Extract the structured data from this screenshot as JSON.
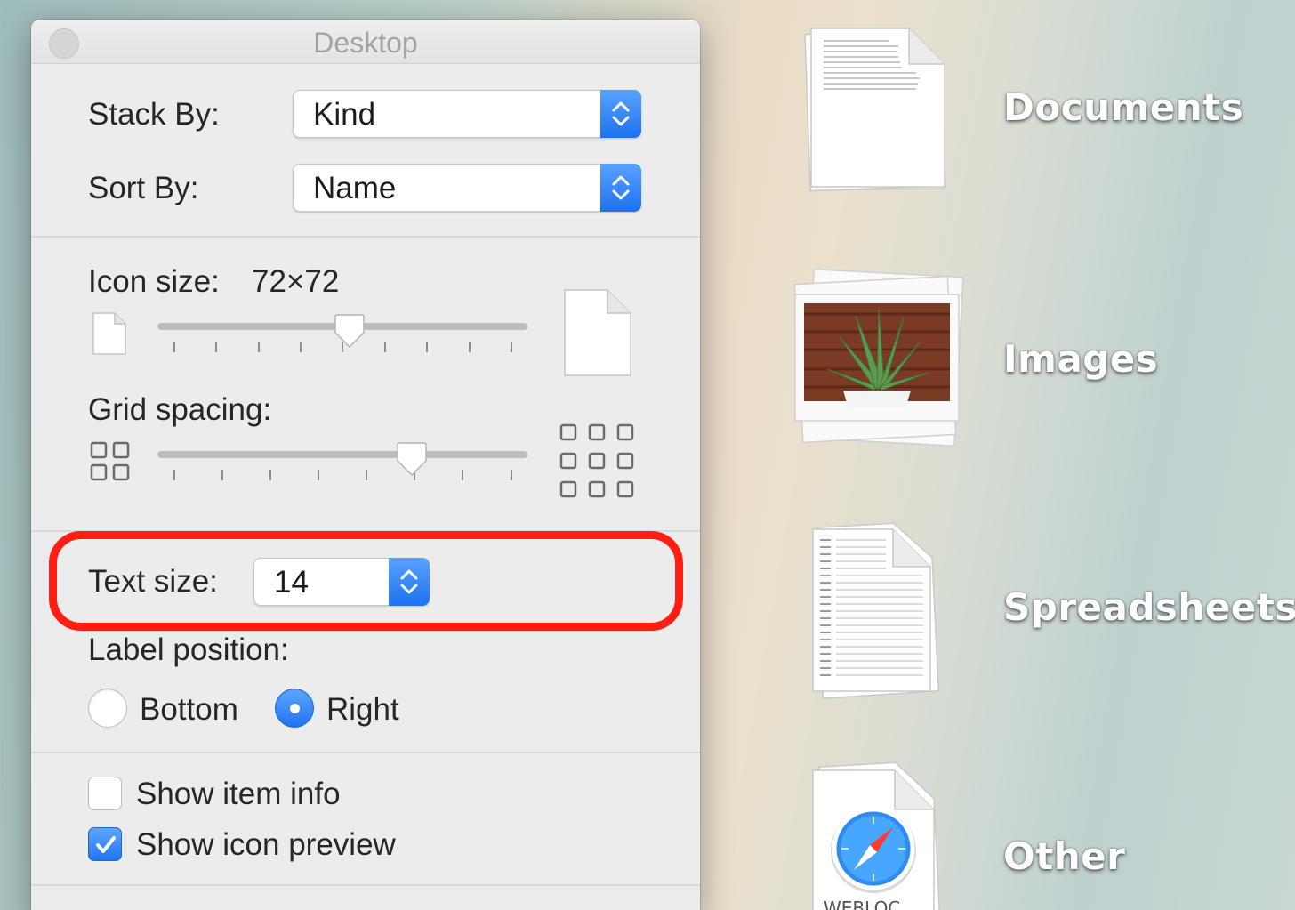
{
  "window": {
    "title": "Desktop"
  },
  "stack_by": {
    "label": "Stack By:",
    "value": "Kind"
  },
  "sort_by": {
    "label": "Sort By:",
    "value": "Name"
  },
  "icon_size": {
    "label": "Icon size:",
    "value": "72×72",
    "slider_level": 0.5
  },
  "grid_spacing": {
    "label": "Grid spacing:",
    "slider_level": 0.69
  },
  "text_size": {
    "label": "Text size:",
    "value": "14"
  },
  "label_position": {
    "label": "Label position:",
    "options": [
      "Bottom",
      "Right"
    ],
    "selected": "Right"
  },
  "checkboxes": {
    "show_item_info": {
      "label": "Show item info",
      "checked": false
    },
    "show_icon_preview": {
      "label": "Show icon preview",
      "checked": true
    }
  },
  "desktop_stacks": [
    {
      "label": "Documents",
      "icon": "documents-stack-icon"
    },
    {
      "label": "Images",
      "icon": "images-stack-icon"
    },
    {
      "label": "Spreadsheets",
      "icon": "spreadsheets-stack-icon"
    },
    {
      "label": "Other",
      "icon": "other-stack-icon"
    }
  ],
  "colors": {
    "accent": "#1f74f2",
    "highlight_ring": "#ff1e14",
    "window_bg": "#ececec"
  }
}
